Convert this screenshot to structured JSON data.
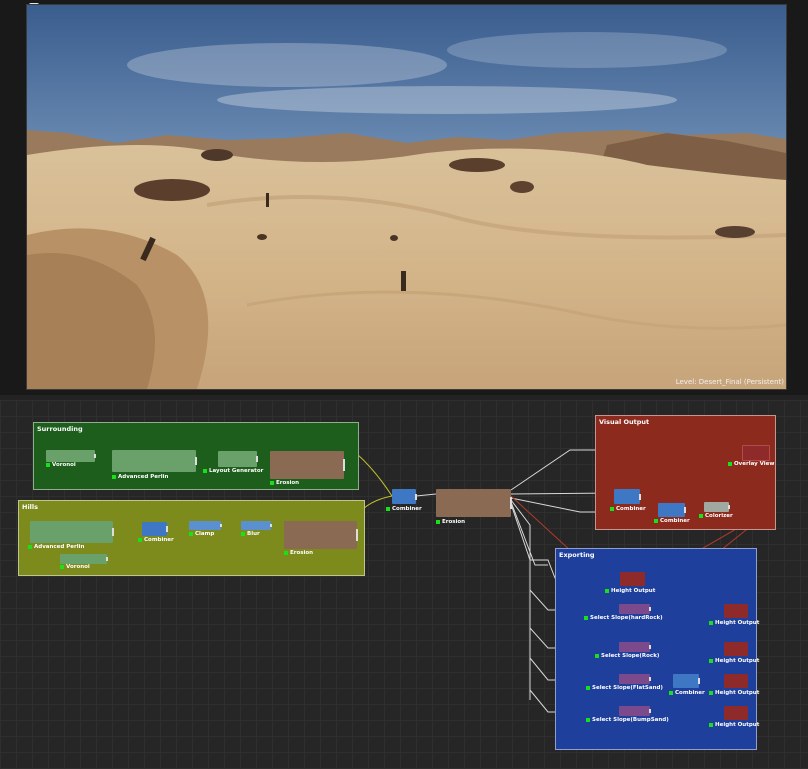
{
  "viewport": {
    "level_label": "Level: Desert_Final (Persistent)",
    "options_icon": "chevron-down-icon"
  },
  "colors": {
    "surrounding_group": "#1d5e1d",
    "hills_group": "#7d8a1c",
    "visual_group": "#8c2a1e",
    "exporting_group": "#1f3f9c",
    "green_node": "#6aa06a",
    "blue_node": "#3e78c4",
    "brown_node": "#8a6a52",
    "red_node": "#8f2a2a",
    "purple_node": "#7a4a8c",
    "pin": "#19e019"
  },
  "groups": {
    "surrounding": "Surrounding",
    "hills": "Hills",
    "visual_output": "Visual Output",
    "exporting": "Exporting"
  },
  "nodes": {
    "s_voronoi": "Voronoi",
    "s_perlin": "Advanced Perlin",
    "s_layout": "Layout Generator",
    "s_erosion": "Erosion",
    "h_perlin": "Advanced Perlin",
    "h_voronoi": "Voronoi",
    "h_combiner": "Combiner",
    "h_clamp": "Clamp",
    "h_blur": "Blur",
    "h_erosion": "Erosion",
    "m_combiner": "Combiner",
    "m_erosion": "Erosion",
    "v_combiner1": "Combiner",
    "v_combiner2": "Combiner",
    "v_colorizer": "Colorizer",
    "v_overlay": "Overlay View",
    "e_height1": "Height Output",
    "e_slope_hardrock": "Select Slope(hardRock)",
    "e_height2": "Height Output",
    "e_slope_rock": "Select Slope(Rock)",
    "e_height3": "Height Output",
    "e_slope_flatsand": "Select Slope(FlatSand)",
    "e_combiner": "Combiner",
    "e_height4": "Height Output",
    "e_slope_bumpsand": "Select Slope(BumpSand)",
    "e_height5": "Height Output"
  }
}
